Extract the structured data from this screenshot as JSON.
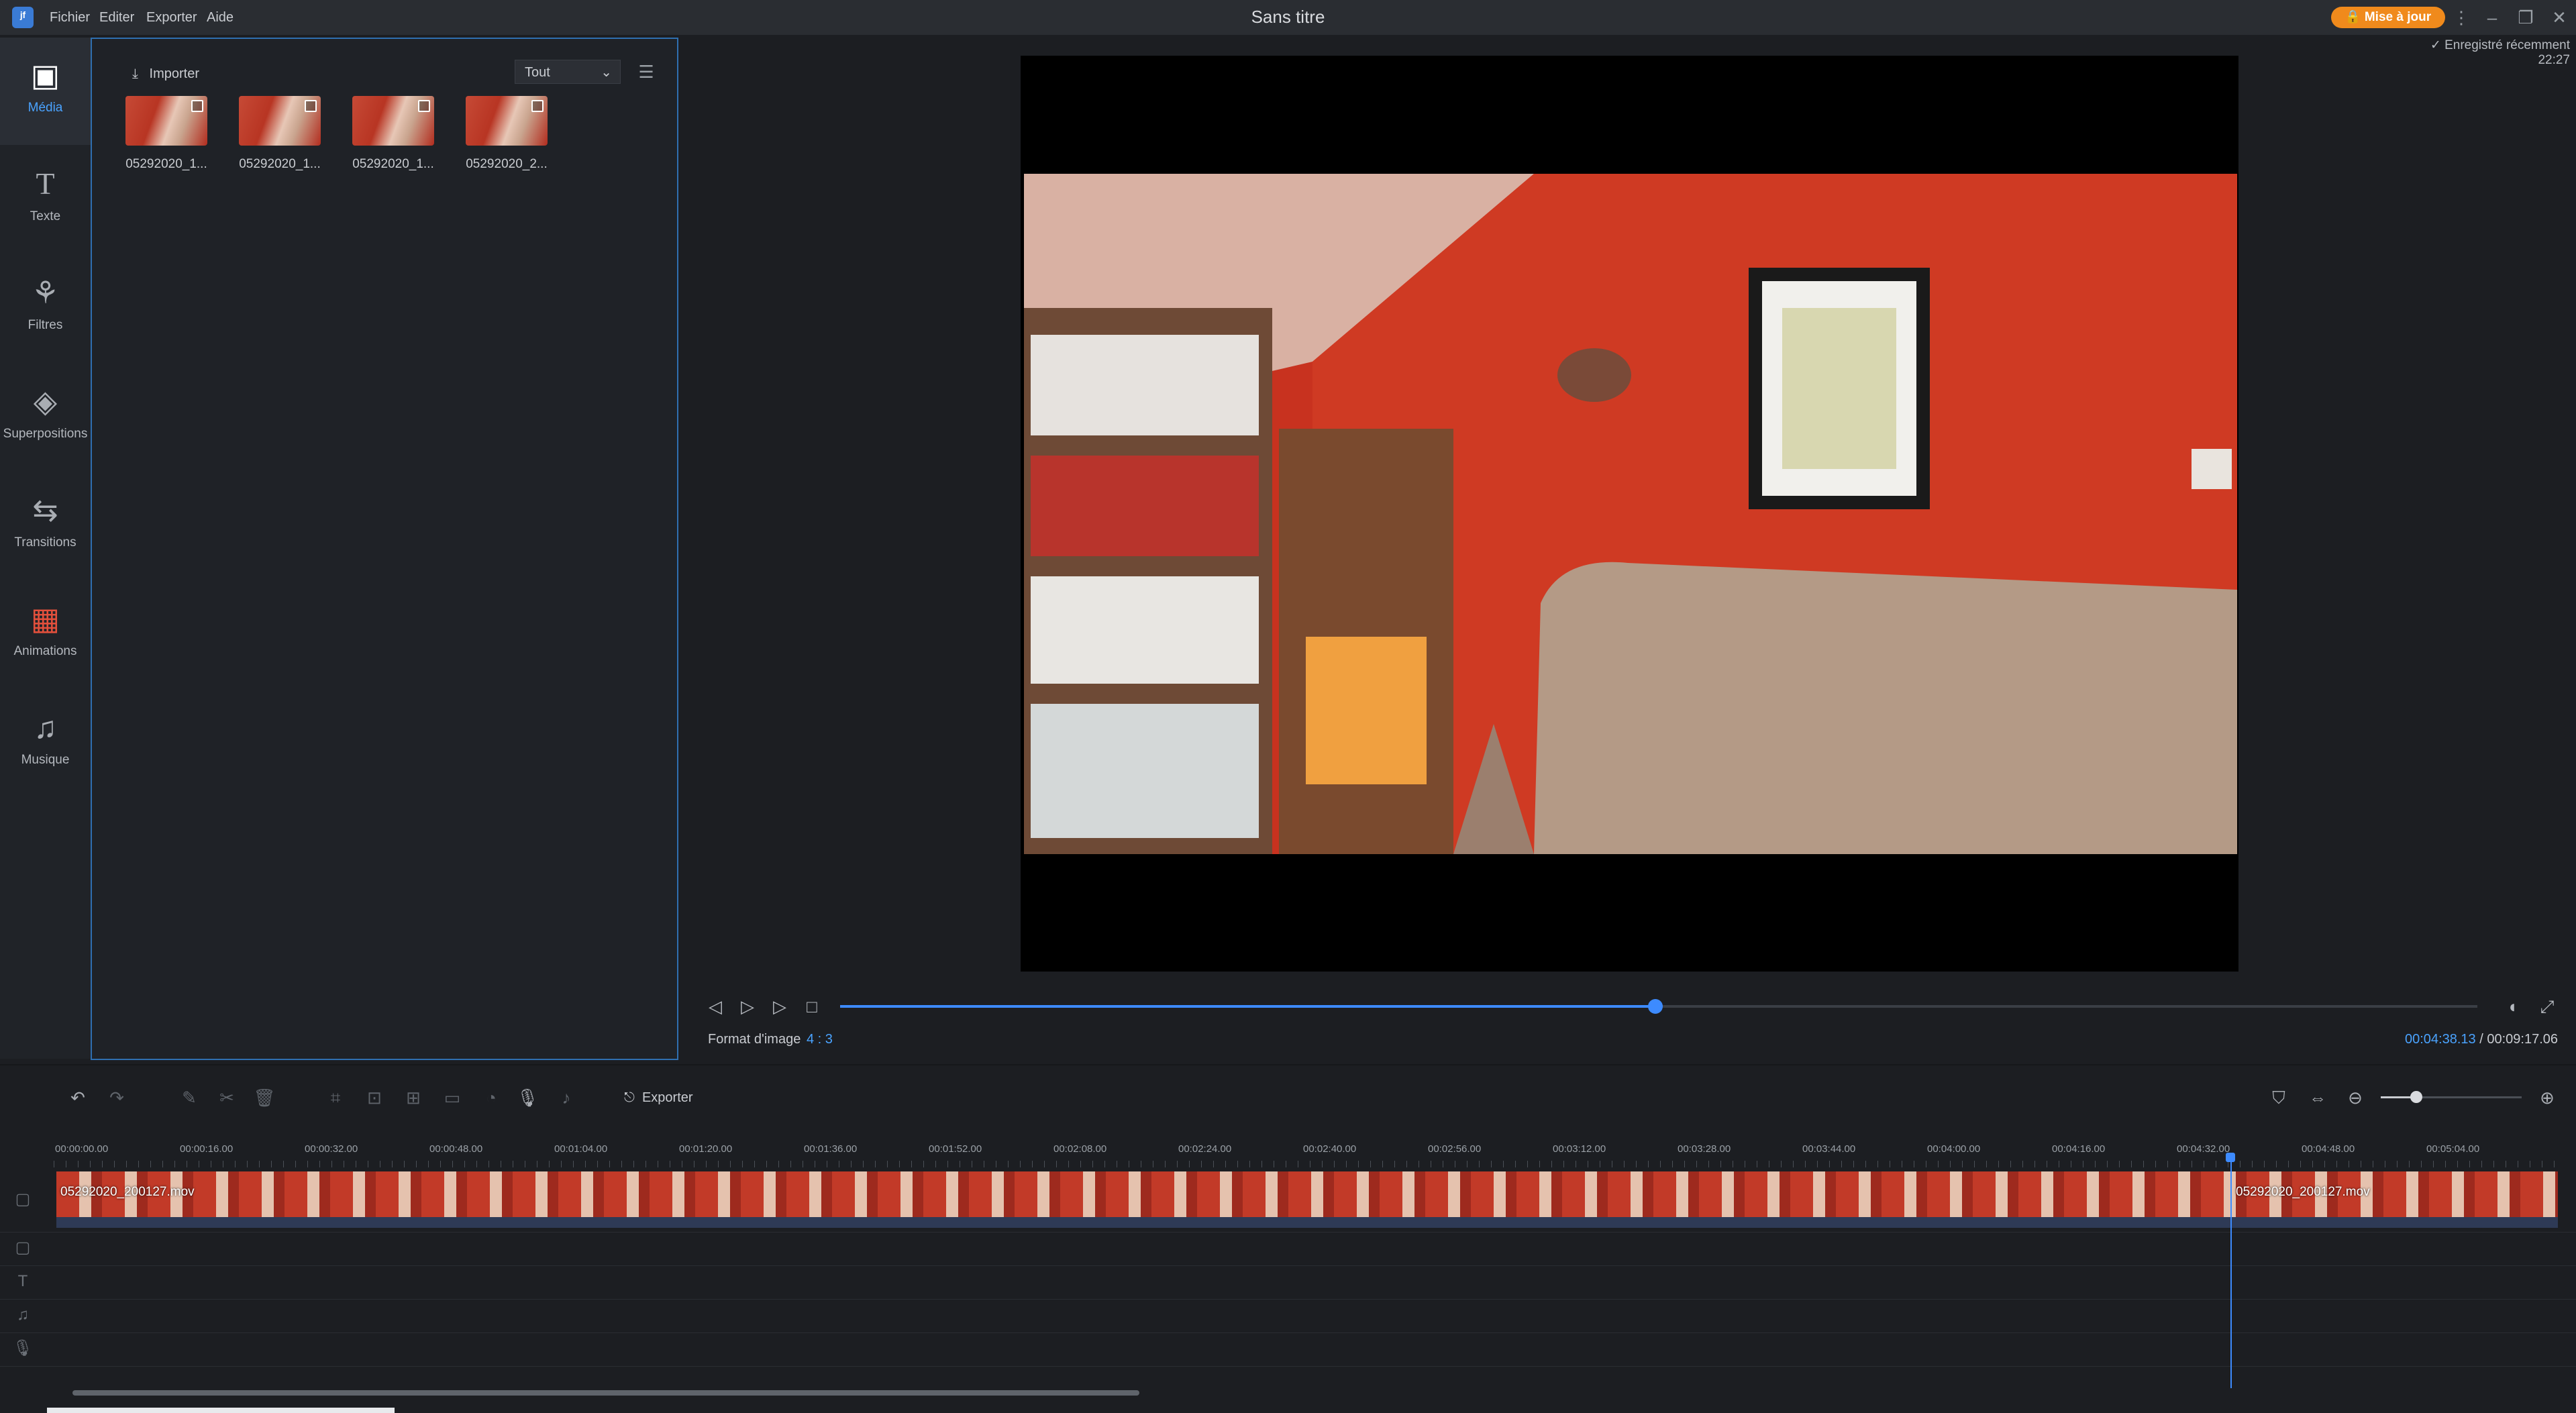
{
  "menu": {
    "app_icon": "app-logo-icon",
    "items": [
      "Fichier",
      "Editer",
      "Exporter",
      "Aide"
    ]
  },
  "window": {
    "title": "Sans titre",
    "upgrade_label": "Mise à jour",
    "saved_status": "Enregistré récemment 22:27"
  },
  "nav": {
    "items": [
      {
        "label": "Média",
        "icon": "media-icon"
      },
      {
        "label": "Texte",
        "icon": "text-icon"
      },
      {
        "label": "Filtres",
        "icon": "filters-icon"
      },
      {
        "label": "Superpositions",
        "icon": "overlays-icon"
      },
      {
        "label": "Transitions",
        "icon": "transitions-icon"
      },
      {
        "label": "Animations",
        "icon": "animations-icon"
      },
      {
        "label": "Musique",
        "icon": "music-icon"
      }
    ]
  },
  "media": {
    "import_label": "Importer",
    "filter_value": "Tout",
    "files": [
      "05292020_1...",
      "05292020_1...",
      "05292020_1...",
      "05292020_2..."
    ]
  },
  "player": {
    "format_label": "Format d'image",
    "format_value": "4 : 3",
    "time_current": "00:04:38.13",
    "time_separator": "/",
    "time_total": "00:09:17.06",
    "progress": 0.498
  },
  "toolbar": {
    "export_label": "Exporter",
    "zoom_level": 0.25
  },
  "timeline": {
    "ticks": [
      "00:00:00.00",
      "00:00:16.00",
      "00:00:32.00",
      "00:00:48.00",
      "00:01:04.00",
      "00:01:20.00",
      "00:01:36.00",
      "00:01:52.00",
      "00:02:08.00",
      "00:02:24.00",
      "00:02:40.00",
      "00:02:56.00",
      "00:03:12.00",
      "00:03:28.00",
      "00:03:44.00",
      "00:04:00.00",
      "00:04:16.00",
      "00:04:32.00",
      "00:04:48.00",
      "00:05:04.00"
    ],
    "clips": [
      "05292020_200127.mov",
      "05292020_200127.mov"
    ]
  },
  "colors": {
    "accent": "#3d8bff",
    "upgrade": "#f08a1c",
    "panel_border": "#2f6fb0"
  }
}
